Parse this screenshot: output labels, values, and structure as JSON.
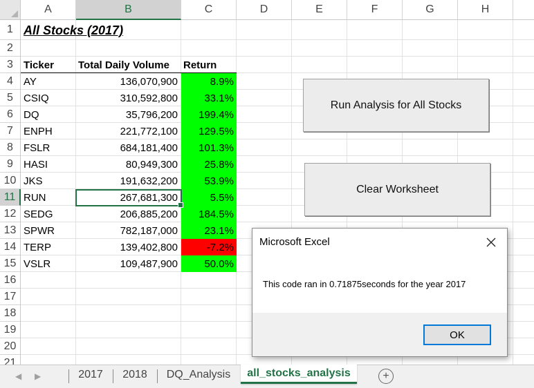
{
  "columns": [
    "A",
    "B",
    "C",
    "D",
    "E",
    "F",
    "G",
    "H"
  ],
  "rows": [
    "1",
    "2",
    "3",
    "4",
    "5",
    "6",
    "7",
    "8",
    "9",
    "10",
    "11",
    "12",
    "13",
    "14",
    "15",
    "16",
    "17",
    "18",
    "19",
    "20",
    "21"
  ],
  "sheet": {
    "title": "All Stocks (2017)",
    "headers": {
      "ticker": "Ticker",
      "volume": "Total Daily Volume",
      "return": "Return"
    },
    "data": [
      {
        "ticker": "AY",
        "volume": "136,070,900",
        "return": "8.9%",
        "status": "positive"
      },
      {
        "ticker": "CSIQ",
        "volume": "310,592,800",
        "return": "33.1%",
        "status": "positive"
      },
      {
        "ticker": "DQ",
        "volume": "35,796,200",
        "return": "199.4%",
        "status": "positive"
      },
      {
        "ticker": "ENPH",
        "volume": "221,772,100",
        "return": "129.5%",
        "status": "positive"
      },
      {
        "ticker": "FSLR",
        "volume": "684,181,400",
        "return": "101.3%",
        "status": "positive"
      },
      {
        "ticker": "HASI",
        "volume": "80,949,300",
        "return": "25.8%",
        "status": "positive"
      },
      {
        "ticker": "JKS",
        "volume": "191,632,200",
        "return": "53.9%",
        "status": "positive"
      },
      {
        "ticker": "RUN",
        "volume": "267,681,300",
        "return": "5.5%",
        "status": "positive"
      },
      {
        "ticker": "SEDG",
        "volume": "206,885,200",
        "return": "184.5%",
        "status": "positive"
      },
      {
        "ticker": "SPWR",
        "volume": "782,187,000",
        "return": "23.1%",
        "status": "positive"
      },
      {
        "ticker": "TERP",
        "volume": "139,402,800",
        "return": "-7.2%",
        "status": "negative"
      },
      {
        "ticker": "VSLR",
        "volume": "109,487,900",
        "return": "50.0%",
        "status": "positive"
      }
    ]
  },
  "buttons": {
    "run": "Run Analysis for All Stocks",
    "clear": "Clear Worksheet"
  },
  "dialog": {
    "title": "Microsoft Excel",
    "message": "This code ran in 0.71875seconds for the year 2017",
    "ok": "OK",
    "close_icon": "close-icon"
  },
  "tabs": [
    {
      "label": "2017"
    },
    {
      "label": "2018"
    },
    {
      "label": "DQ_Analysis"
    },
    {
      "label": "all_stocks_analysis",
      "active": true
    }
  ],
  "colors": {
    "positive": "#00ff00",
    "negative": "#ff0000",
    "accent": "#217346",
    "dialog_focus": "#0078d7"
  }
}
